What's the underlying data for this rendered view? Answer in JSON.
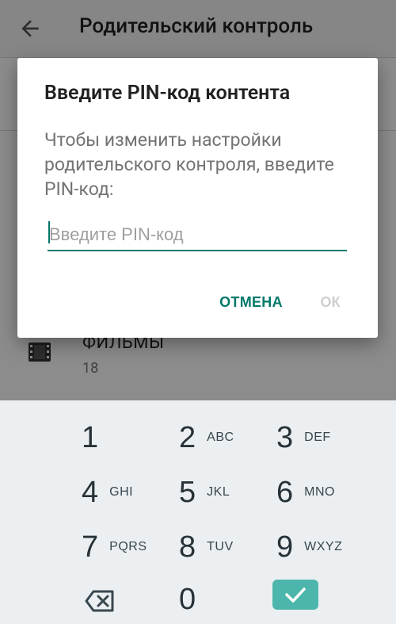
{
  "appbar": {
    "title": "Родительский контроль",
    "back_icon": "arrow-back-icon"
  },
  "settings": {
    "movies": {
      "title": "ФИЛЬМЫ",
      "value": "18",
      "icon": "film-icon"
    }
  },
  "dialog": {
    "title": "Введите PIN-код контента",
    "message": "Чтобы изменить настройки родительского контроля, введите PIN-код:",
    "input": {
      "value": "",
      "placeholder": "Введите PIN-код"
    },
    "cancel_label": "ОТМЕНА",
    "ok_label": "ОК",
    "accent_color": "#00796b"
  },
  "keyboard": {
    "keys": [
      {
        "digit": "1",
        "letters": ""
      },
      {
        "digit": "2",
        "letters": "ABC"
      },
      {
        "digit": "3",
        "letters": "DEF"
      },
      {
        "digit": "4",
        "letters": "GHI"
      },
      {
        "digit": "5",
        "letters": "JKL"
      },
      {
        "digit": "6",
        "letters": "MNO"
      },
      {
        "digit": "7",
        "letters": "PQRS"
      },
      {
        "digit": "8",
        "letters": "TUV"
      },
      {
        "digit": "9",
        "letters": "WXYZ"
      },
      {
        "digit": "0",
        "letters": ""
      }
    ],
    "backspace_icon": "backspace-icon",
    "enter_icon": "checkmark-icon",
    "enter_color": "#4db6ac"
  }
}
